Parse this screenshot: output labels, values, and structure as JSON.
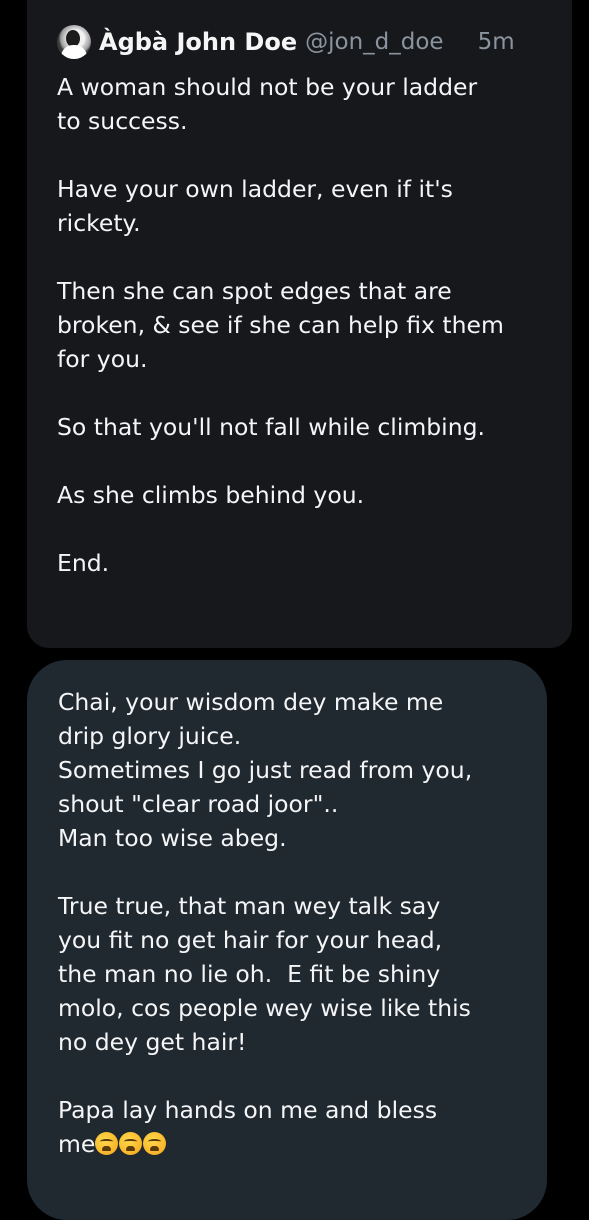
{
  "quoted_post": {
    "author_name": "Àgbà John Doe",
    "author_handle": "@jon_d_doe",
    "timestamp": "5m",
    "avatar_icon": "user-avatar",
    "text": "A woman should not be your ladder\nto success.\n\nHave your own ladder, even if it's\nrickety.\n\nThen she can spot edges that are\nbroken, & see if she can help fix them\nfor you.\n\nSo that you'll not fall while climbing.\n\nAs she climbs behind you.\n\nEnd."
  },
  "reply": {
    "text_main": "Chai, your wisdom dey make me\ndrip glory juice.\nSometimes I go just read from you,\nshout \"clear road joor\"..\nMan too wise abeg.\n\nTrue true, that man wey talk say\nyou fit no get hair for your head,\nthe man no lie oh.  E fit be shiny\nmolo, cos people wey wise like this\nno dey get hair!\n\nPapa lay hands on me and bless\nme",
    "emoji": [
      "weary-face-emoji",
      "weary-face-emoji",
      "weary-face-emoji"
    ]
  },
  "colors": {
    "background": "#000000",
    "quoted_card": "#16181c",
    "reply_bubble": "#202830",
    "secondary_text": "#8b949e"
  }
}
